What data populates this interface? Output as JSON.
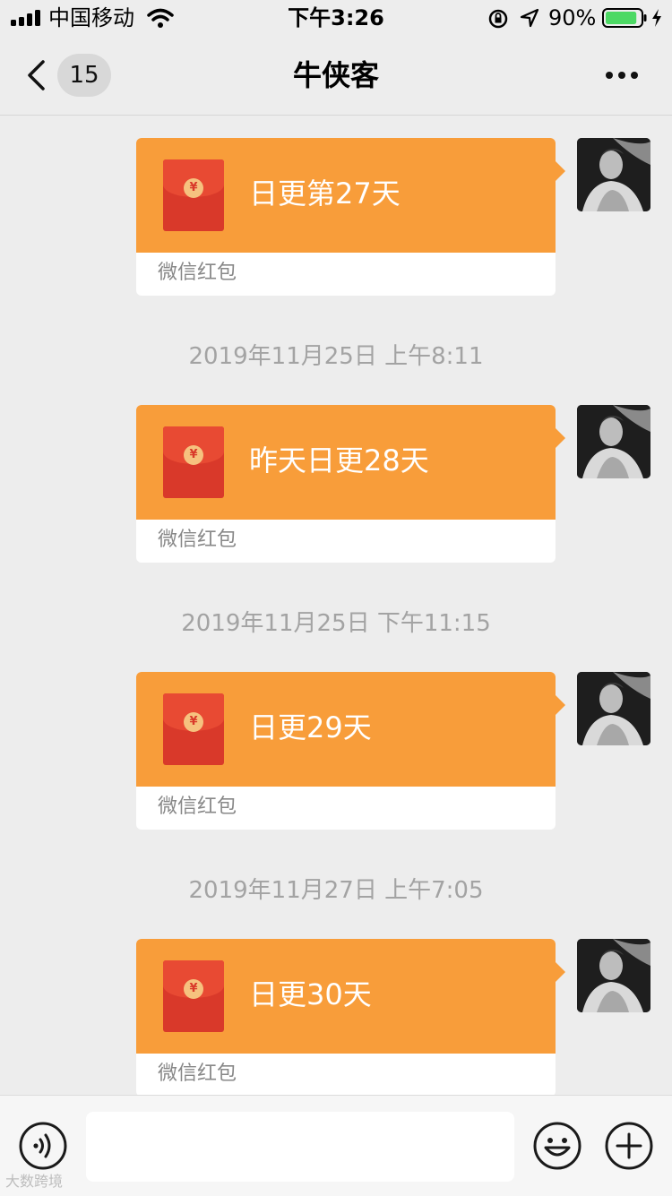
{
  "status_bar": {
    "carrier": "中国移动",
    "time": "下午3:26",
    "battery_percent": "90%",
    "battery_level": 0.9,
    "battery_color": "#4cd964"
  },
  "nav": {
    "back_icon": "chevron-left-icon",
    "unread_count": "15",
    "title": "牛侠客",
    "more_icon": "more-dots-icon"
  },
  "messages": [
    {
      "type": "red_packet",
      "title": "日更第27天",
      "footer": "微信红包"
    },
    {
      "type": "timestamp",
      "text": "2019年11月25日 上午8:11"
    },
    {
      "type": "red_packet",
      "title": "昨天日更28天",
      "footer": "微信红包"
    },
    {
      "type": "timestamp",
      "text": "2019年11月25日 下午11:15"
    },
    {
      "type": "red_packet",
      "title": "日更29天",
      "footer": "微信红包"
    },
    {
      "type": "timestamp",
      "text": "2019年11月27日 上午7:05"
    },
    {
      "type": "red_packet",
      "title": "日更30天",
      "footer": "微信红包"
    }
  ],
  "colors": {
    "red_packet_orange": "#f89d3a",
    "envelope_red": "#d9392a",
    "background": "#ededed"
  },
  "input_bar": {
    "voice_icon": "voice-icon",
    "emoji_icon": "emoji-icon",
    "plus_icon": "plus-icon"
  },
  "watermark": "大数跨境"
}
